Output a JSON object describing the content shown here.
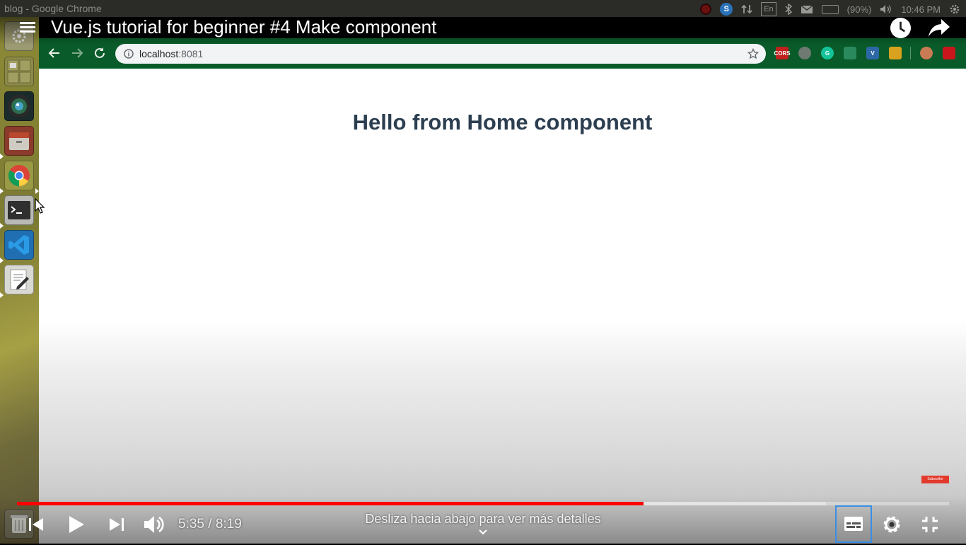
{
  "os": {
    "window_title": "blog - Google Chrome",
    "tray": {
      "skype_letter": "S",
      "keyboard_layout": "En",
      "battery": "(90%)",
      "clock": "10:46 PM"
    }
  },
  "launcher": {
    "items": [
      {
        "name": "system-settings"
      },
      {
        "name": "workspace-switcher"
      },
      {
        "name": "camera-app"
      },
      {
        "name": "files-app"
      },
      {
        "name": "chrome-app"
      },
      {
        "name": "terminal-app"
      },
      {
        "name": "vscode-app"
      },
      {
        "name": "text-editor-app"
      },
      {
        "name": "trash"
      }
    ]
  },
  "youtube": {
    "title": "Vue.js tutorial for beginner #4 Make component",
    "time_current": "5:35",
    "time_separator": "/",
    "time_total": "8:19",
    "played_fraction": 0.672,
    "loaded_fraction": 0.868,
    "swipe_hint": "Desliza hacia abajo para ver más detalles",
    "subscribe_badge": "Subscribe",
    "accent_color": "#ff0000"
  },
  "browser": {
    "url_host": "localhost",
    "url_port": ":8081",
    "extensions": [
      {
        "name": "cors-extension",
        "label": "CORS",
        "color": "#c0201e"
      },
      {
        "name": "target-extension",
        "label": "",
        "color": "#6e7a72"
      },
      {
        "name": "grammarly-extension",
        "label": "G",
        "color": "#15c39a"
      },
      {
        "name": "react-devtools-extension",
        "label": "",
        "color": "#2b8a5d"
      },
      {
        "name": "vue-devtools-extension",
        "label": "V",
        "color": "#2d67a6"
      },
      {
        "name": "pencil-extension",
        "label": "",
        "color": "#d8a21e"
      },
      {
        "name": "avatar-extension",
        "label": "",
        "color": "#c97b54"
      },
      {
        "name": "upload-extension",
        "label": "",
        "color": "#c9161d"
      }
    ]
  },
  "page": {
    "heading": "Hello from Home component"
  }
}
